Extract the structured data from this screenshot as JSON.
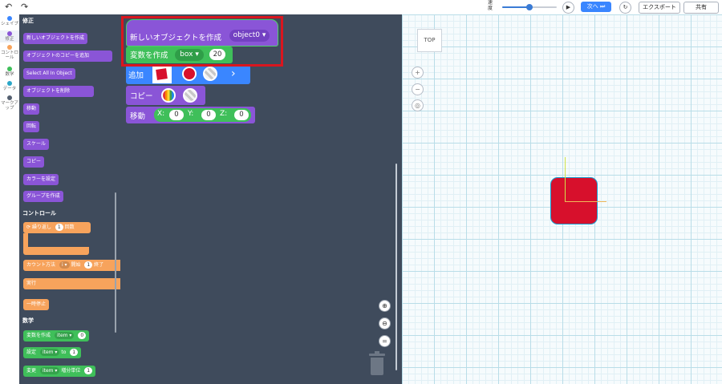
{
  "toolbar": {
    "undo_icon": "undo-arrow",
    "redo_icon": "redo-arrow",
    "speed_label": "速度",
    "speed_value": 0.5,
    "play_icon": "play",
    "next_label": "次へ",
    "step_icon": "step-forward",
    "reset_icon": "reset",
    "export_label": "エクスポート",
    "share_label": "共有"
  },
  "categories": [
    {
      "label": "シェイプ",
      "color": "#3a86ff",
      "active": false
    },
    {
      "label": "修正",
      "color": "#8a55d7",
      "active": true
    },
    {
      "label": "コントロール",
      "color": "#f7a35c",
      "active": false
    },
    {
      "label": "数学",
      "color": "#3fbf5a",
      "active": false
    },
    {
      "label": "データ",
      "color": "#2aa6c7",
      "active": false
    },
    {
      "label": "マークアップ",
      "color": "#556070",
      "active": false
    }
  ],
  "flyout": {
    "section_modify": "修正",
    "modify_blocks": [
      "新しいオブジェクトを作成",
      "オブジェクトのコピーを追加",
      "Select All In Object",
      "オブジェクトを削除",
      "移動",
      "回転",
      "スケール",
      "コピー",
      "カラーを設定",
      "グループを作成"
    ],
    "section_control": "コントロール",
    "repeat_label": "繰り返し",
    "repeat_count": "1",
    "repeat_unit": "回数",
    "count_label": "カウント方法",
    "count_var": "i",
    "count_start_label": "開始",
    "count_start": "1",
    "count_end_label": "終了",
    "do_label": "実行",
    "pause_label": "一時停止",
    "section_math": "数学",
    "math_create_label": "変数を作成",
    "math_create_var": "item",
    "math_create_value": "0",
    "math_set_label": "設定",
    "math_set_var": "item",
    "math_set_to": "to",
    "math_set_value": "1",
    "math_change_label": "変更",
    "math_change_var": "item",
    "math_change_by": "増分単位",
    "math_change_value": "1"
  },
  "workspace": {
    "new_object_label": "新しいオブジェクトを作成",
    "new_object_value": "object0",
    "variable_label": "変数を作成",
    "variable_name": "box",
    "variable_value": "20",
    "add_label": "追加",
    "copy_label": "コピー",
    "move_label": "移動",
    "move_x_label": "X:",
    "move_x": "0",
    "move_y_label": "Y:",
    "move_y": "0",
    "move_z_label": "Z:",
    "move_z": "0"
  },
  "viewport": {
    "viewcube_label": "TOP",
    "object_color": "#d7102c"
  }
}
